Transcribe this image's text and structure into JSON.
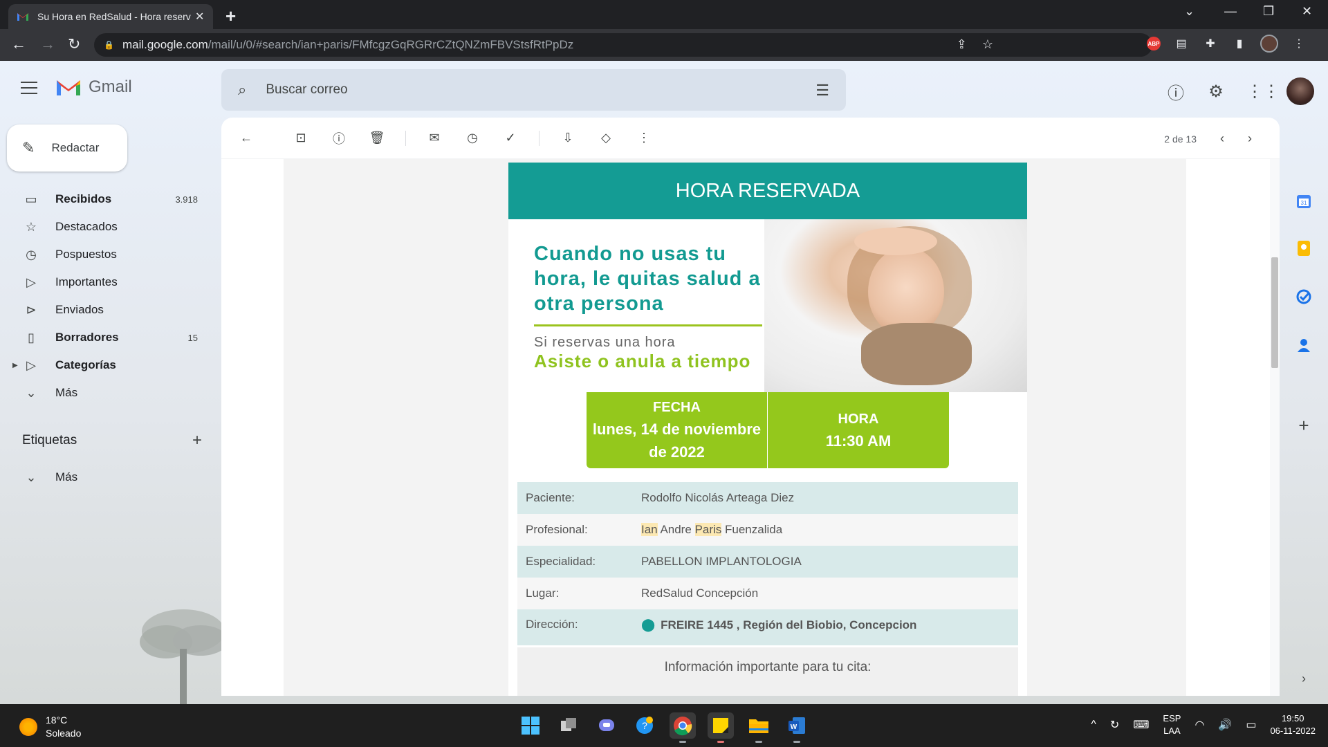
{
  "browser": {
    "tab_title": "Su Hora en RedSalud - Hora reservada",
    "url_host": "mail.google.com",
    "url_path": "/mail/u/0/#search/ian+paris/FMfcgzGqRGRrCZtQNZmFBVStsfRtPpDz",
    "new_tab": "+"
  },
  "gmail": {
    "logo_text": "Gmail",
    "search_placeholder": "Buscar correo",
    "compose_label": "Redactar",
    "nav": [
      {
        "label": "Recibidos",
        "count": "3.918",
        "bold": true,
        "icon": "inbox-icon"
      },
      {
        "label": "Destacados",
        "count": "",
        "bold": false,
        "icon": "star-icon"
      },
      {
        "label": "Pospuestos",
        "count": "",
        "bold": false,
        "icon": "clock-icon"
      },
      {
        "label": "Importantes",
        "count": "",
        "bold": false,
        "icon": "important-icon"
      },
      {
        "label": "Enviados",
        "count": "",
        "bold": false,
        "icon": "send-icon"
      },
      {
        "label": "Borradores",
        "count": "15",
        "bold": true,
        "icon": "draft-icon"
      },
      {
        "label": "Categorías",
        "count": "",
        "bold": true,
        "icon": "label-icon"
      },
      {
        "label": "Más",
        "count": "",
        "bold": false,
        "icon": "chevron-down-icon"
      }
    ],
    "labels_title": "Etiquetas",
    "labels_more": "Más",
    "pager": "2 de 13"
  },
  "email": {
    "header": "HORA RESERVADA",
    "banner_headline": "Cuando no usas tu hora, le quitas salud a otra persona",
    "banner_sub": "Si reservas una hora",
    "banner_cta": "Asiste o anula a tiempo",
    "fecha_label": "FECHA",
    "fecha_value": "lunes, 14 de noviembre de 2022",
    "hora_label": "HORA",
    "hora_value": "11:30 AM",
    "paciente_label": "Paciente:",
    "paciente_value": "Rodolfo Nicolás Arteaga Diez",
    "profesional_label": "Profesional:",
    "profesional_first": "Ian",
    "profesional_middle": "Andre",
    "profesional_last": "Paris",
    "profesional_last2": "Fuenzalida",
    "especialidad_label": "Especialidad:",
    "especialidad_value": "PABELLON IMPLANTOLOGIA",
    "lugar_label": "Lugar:",
    "lugar_value": "RedSalud Concepción",
    "direccion_label": "Dirección:",
    "direccion_value": "FREIRE 1445 , Región del Biobio, Concepcion",
    "info_footer": "Información importante para tu cita:"
  },
  "taskbar": {
    "temperature": "18°C",
    "weather": "Soleado",
    "lang_top": "ESP",
    "lang_bottom": "LAA",
    "time": "19:50",
    "date": "06-11-2022"
  },
  "colors": {
    "teal": "#149c94",
    "green": "#94c81c",
    "highlight": "#fce8b2"
  }
}
